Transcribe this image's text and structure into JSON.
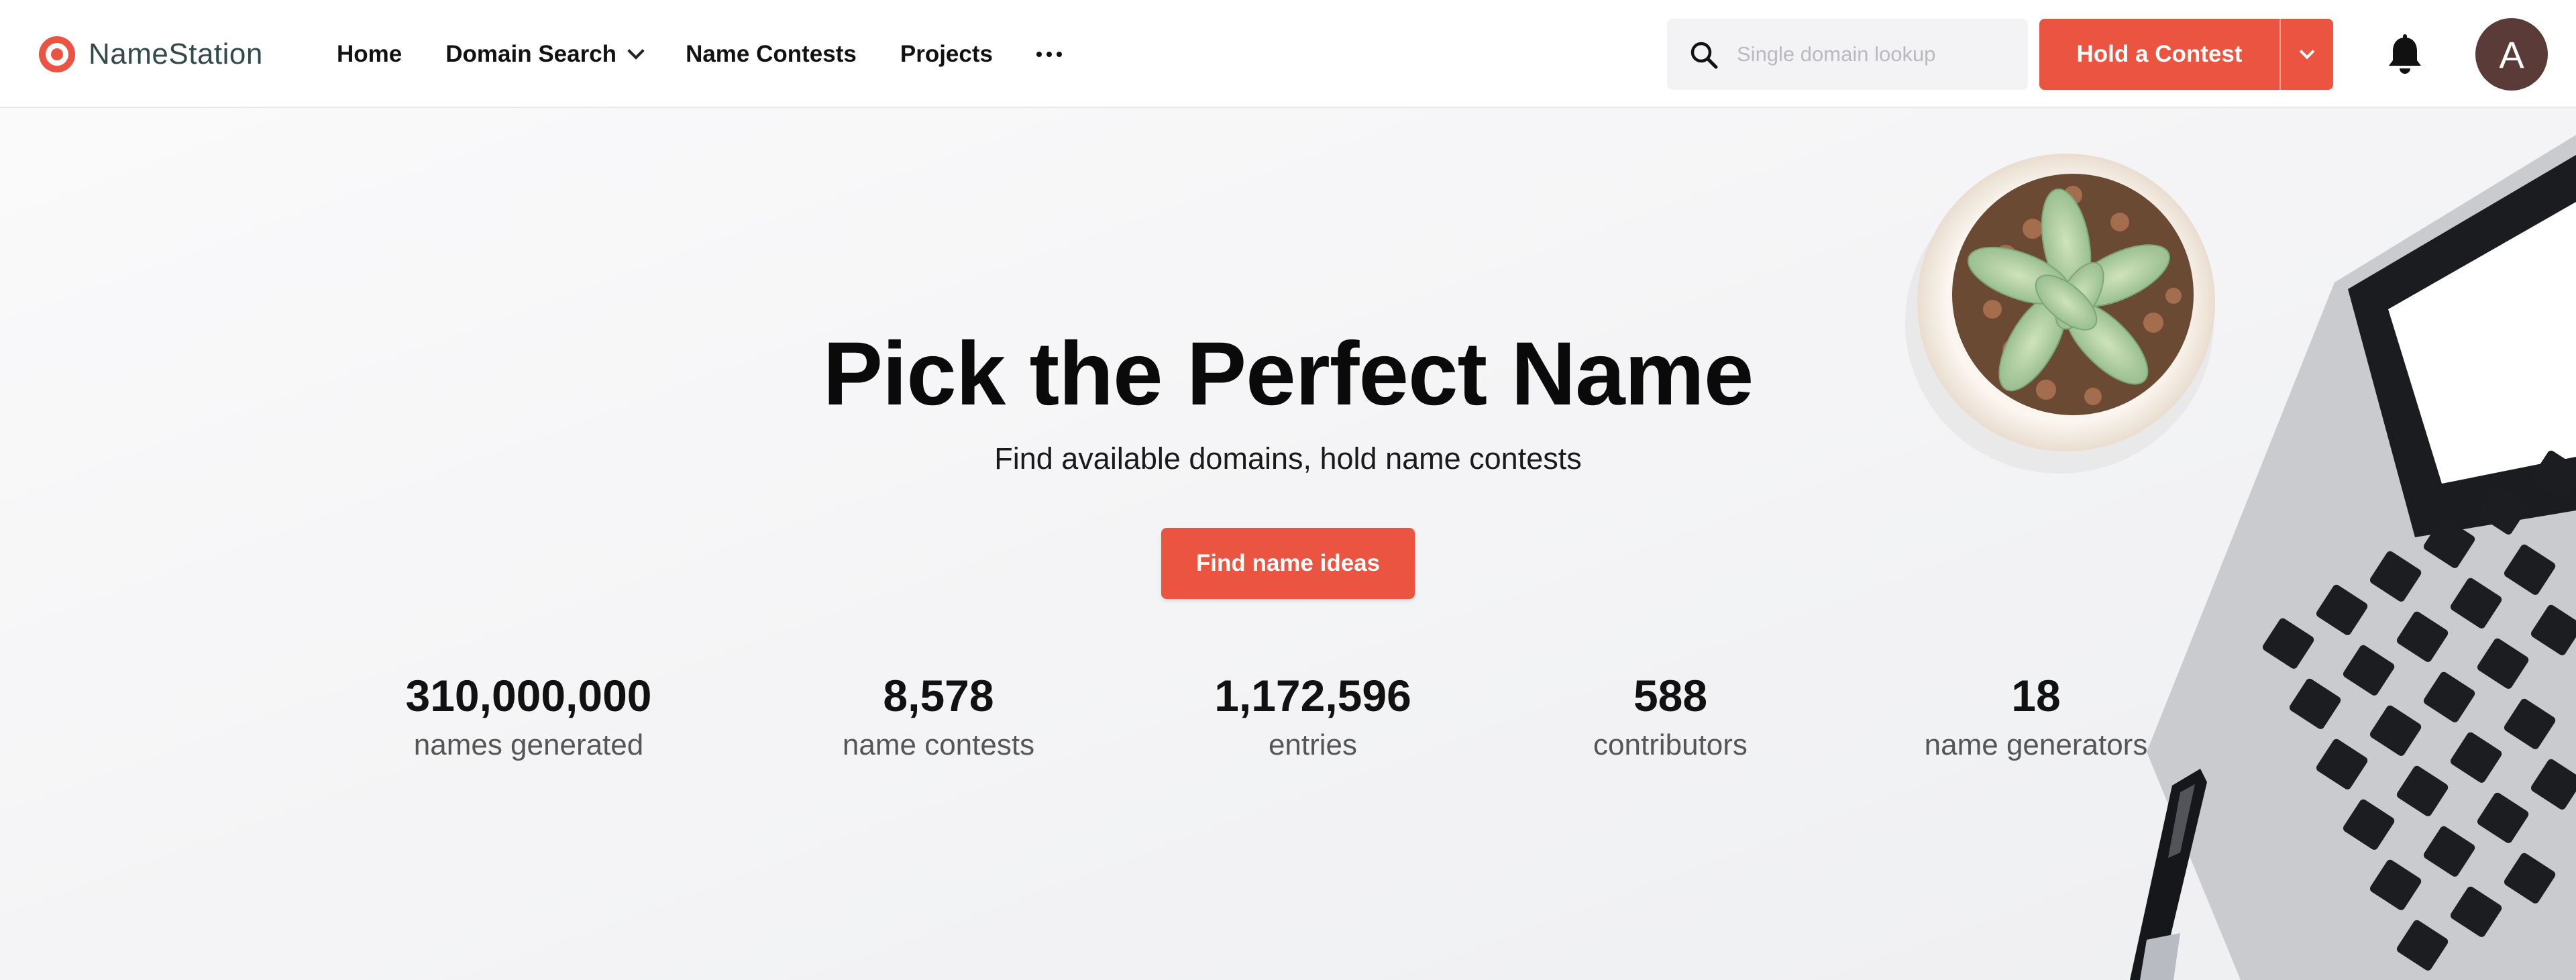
{
  "brand": {
    "name": "NameStation"
  },
  "nav": {
    "links": [
      {
        "label": "Home"
      },
      {
        "label": "Domain Search"
      },
      {
        "label": "Name Contests"
      },
      {
        "label": "Projects"
      }
    ],
    "more_icon": "more-horizontal-icon"
  },
  "search": {
    "placeholder": "Single domain lookup",
    "value": ""
  },
  "contest_button": {
    "label": "Hold a Contest"
  },
  "user": {
    "avatar_initial": "A"
  },
  "colors": {
    "accent": "#ea5440",
    "brand_text": "#334a4a",
    "avatar_bg": "#5b3b37"
  },
  "hero": {
    "title": "Pick the Perfect Name",
    "subtitle": "Find available domains, hold name contests",
    "cta_label": "Find name ideas"
  },
  "stats": [
    {
      "value": "310,000,000",
      "label": "names generated"
    },
    {
      "value": "8,578",
      "label": "name contests"
    },
    {
      "value": "1,172,596",
      "label": "entries"
    },
    {
      "value": "588",
      "label": "contributors"
    },
    {
      "value": "18",
      "label": "name generators"
    }
  ]
}
